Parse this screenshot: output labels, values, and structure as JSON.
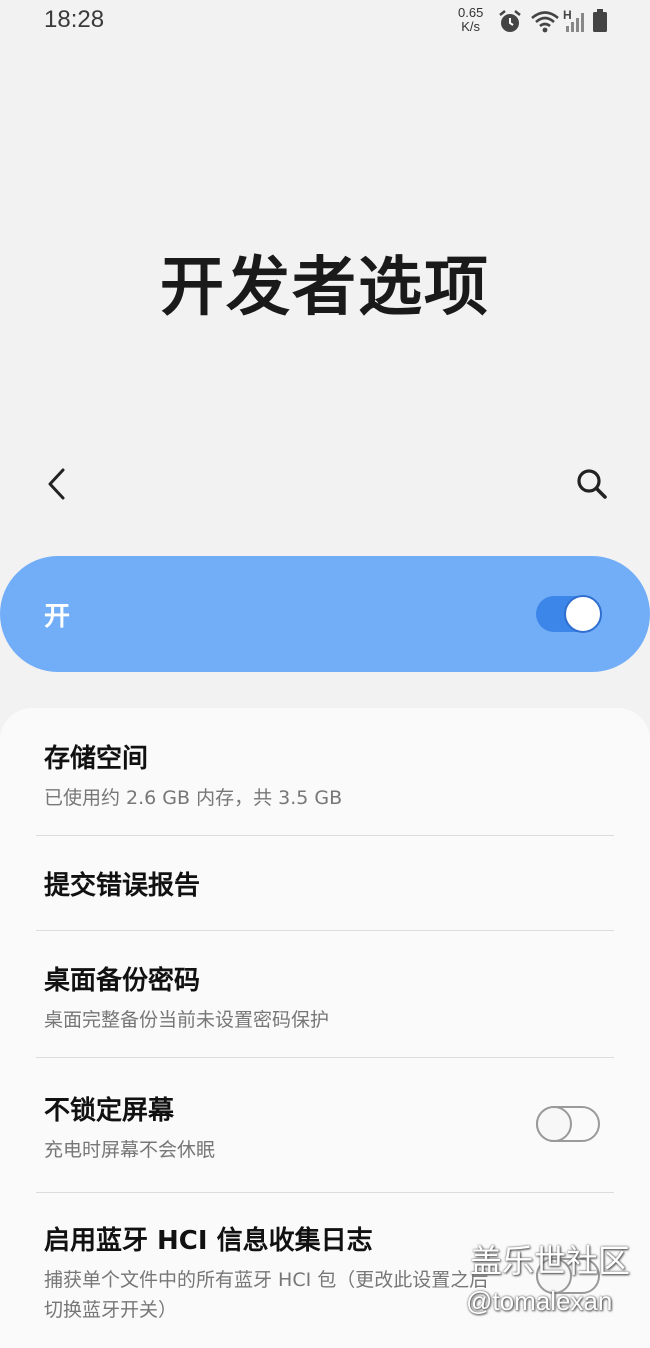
{
  "status_bar": {
    "time": "18:28",
    "net_speed_value": "0.65",
    "net_speed_unit": "K/s",
    "network_type": "H",
    "icons": [
      "alarm-icon",
      "wifi-icon",
      "signal-icon",
      "battery-icon"
    ]
  },
  "page": {
    "title": "开发者选项"
  },
  "nav": {
    "back_icon": "back-arrow-icon",
    "search_icon": "search-icon"
  },
  "master_switch": {
    "label": "开",
    "state": "on",
    "color": "#72aef8"
  },
  "settings": [
    {
      "title": "存储空间",
      "subtitle": "已使用约 2.6 GB 内存，共 3.5 GB"
    },
    {
      "title": "提交错误报告",
      "subtitle": ""
    },
    {
      "title": "桌面备份密码",
      "subtitle": "桌面完整备份当前未设置密码保护"
    },
    {
      "title": "不锁定屏幕",
      "subtitle": "充电时屏幕不会休眠",
      "toggle": "off"
    },
    {
      "title": "启用蓝牙 HCI 信息收集日志",
      "subtitle": "捕获单个文件中的所有蓝牙 HCI 包（更改此设置之后切换蓝牙开关）",
      "toggle": "off"
    }
  ],
  "watermark": {
    "line1": "盖乐世社区",
    "line2": "@tomalexan"
  }
}
